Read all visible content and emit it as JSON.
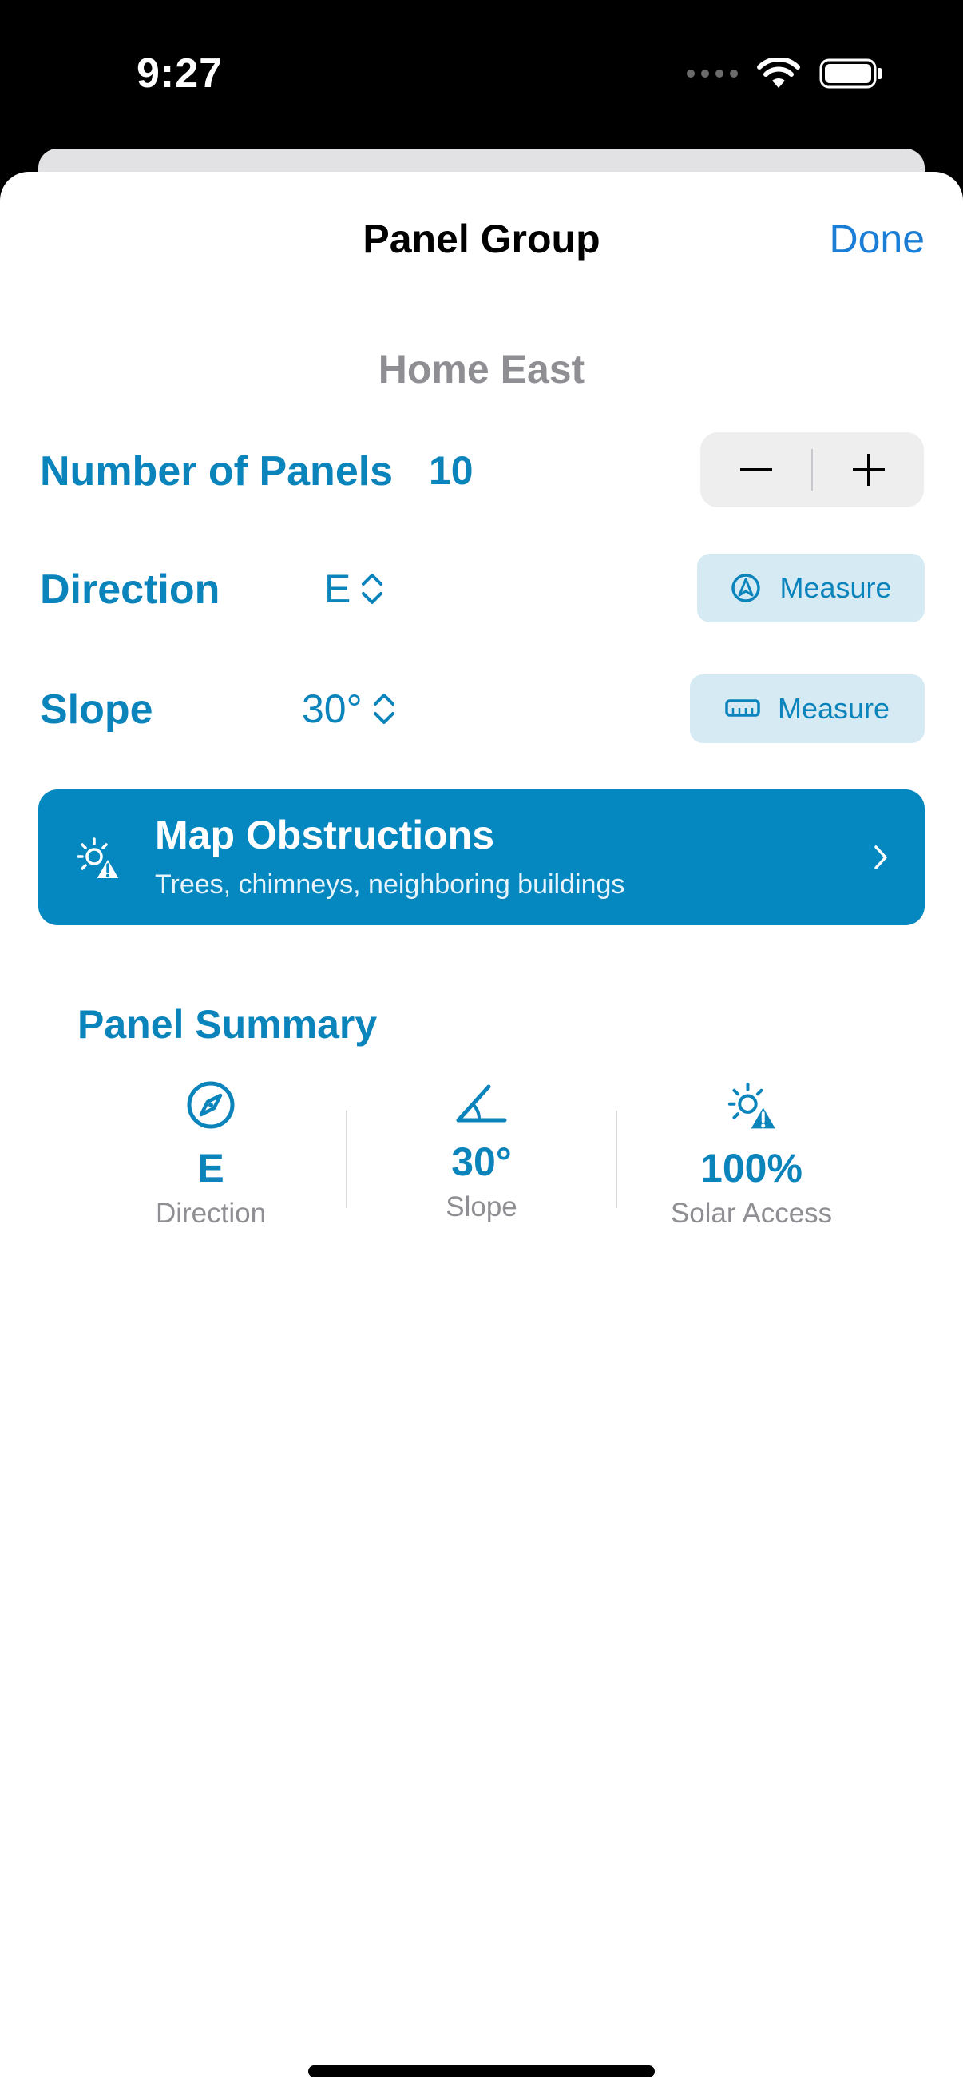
{
  "status_bar": {
    "time": "9:27"
  },
  "nav": {
    "title": "Panel Group",
    "done_label": "Done"
  },
  "group_name": "Home East",
  "panels": {
    "label": "Number of Panels",
    "value": "10"
  },
  "direction": {
    "label": "Direction",
    "value": "E",
    "measure_label": "Measure"
  },
  "slope": {
    "label": "Slope",
    "value": "30°",
    "measure_label": "Measure"
  },
  "obstructions": {
    "title": "Map Obstructions",
    "subtitle": "Trees, chimneys, neighboring buildings"
  },
  "summary": {
    "title": "Panel Summary",
    "items": [
      {
        "value": "E",
        "label": "Direction",
        "icon": "compass-icon"
      },
      {
        "value": "30°",
        "label": "Slope",
        "icon": "angle-icon"
      },
      {
        "value": "100%",
        "label": "Solar Access",
        "icon": "sun-warning-icon"
      }
    ]
  },
  "colors": {
    "accent": "#0b84bb",
    "link": "#1a7ed6",
    "banner": "#0587bf",
    "measure_bg": "#d6eaf4"
  }
}
